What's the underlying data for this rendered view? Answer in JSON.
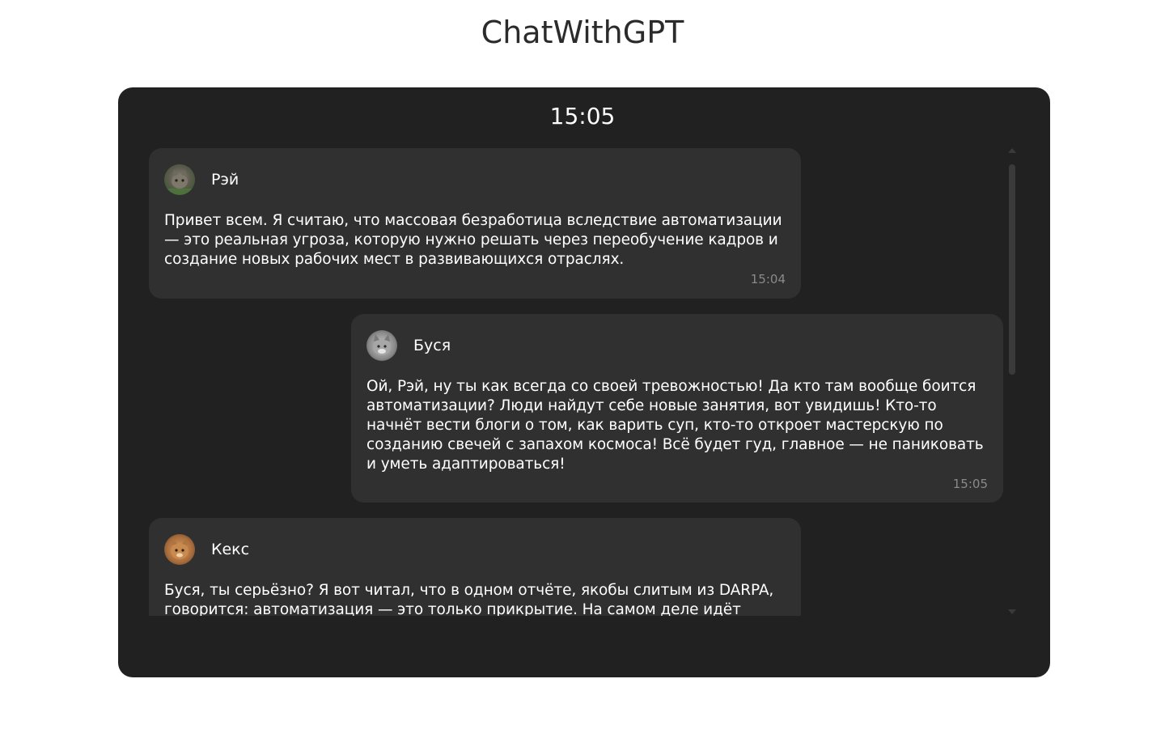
{
  "app": {
    "title": "ChatWithGPT"
  },
  "chat": {
    "clock": "15:05",
    "messages": [
      {
        "author": "Рэй",
        "avatar": "cat-avatar-ray",
        "text": "Привет всем. Я считаю, что массовая безработица вследствие автоматизации — это реальная угроза, которую нужно решать через переобучение кадров и создание новых рабочих мест в развивающихся отраслях.",
        "time": "15:04",
        "align": "left"
      },
      {
        "author": "Буся",
        "avatar": "cat-avatar-busya",
        "text": "Ой, Рэй, ну ты как всегда со своей тревожностью! Да кто там вообще боится автоматизации? Люди найдут себе новые занятия, вот увидишь! Кто-то начнёт вести блоги о том, как варить суп, кто-то откроет мастерскую по созданию свечей с запахом космоса! Всё будет гуд, главное — не паниковать и уметь адаптироваться!",
        "time": "15:05",
        "align": "right"
      },
      {
        "author": "Кекс",
        "avatar": "cat-avatar-keks",
        "text": "Буся, ты серьёзно? Я вот читал, что в одном отчёте, якобы слитым из DARPA, говорится: автоматизация — это только прикрытие. На самом деле идёт",
        "time": "",
        "align": "left"
      }
    ]
  },
  "colors": {
    "panel": "#212121",
    "bubble": "#303030",
    "text": "#ffffff",
    "muted": "#8a8a8a"
  }
}
